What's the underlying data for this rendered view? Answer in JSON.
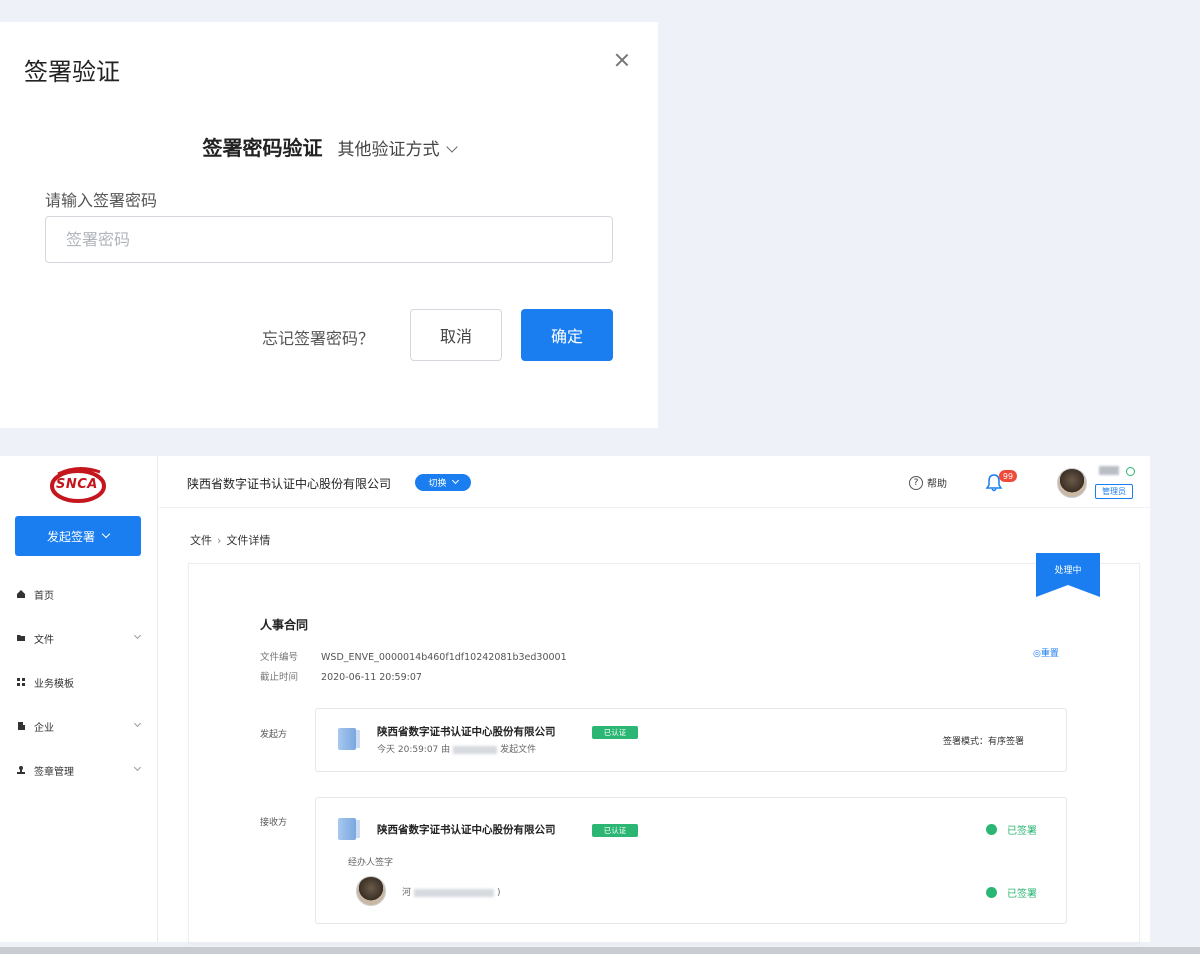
{
  "modal": {
    "title": "签署验证",
    "method": "签署密码验证",
    "other_method": "其他验证方式",
    "password_label": "请输入签署密码",
    "password_placeholder": "签署密码",
    "password_value": "",
    "forgot_link": "忘记签署密码？",
    "cancel_label": "取消",
    "confirm_label": "确定",
    "accent_color": "#1a7ef0"
  },
  "sidebar": {
    "logo_text": "SNCA",
    "start_button": "发起签署",
    "items": [
      {
        "label": "首页",
        "icon": "home-icon",
        "has_submenu": false
      },
      {
        "label": "文件",
        "icon": "folder-icon",
        "has_submenu": true
      },
      {
        "label": "业务模板",
        "icon": "grid-icon",
        "has_submenu": false
      },
      {
        "label": "企业",
        "icon": "building-icon",
        "has_submenu": true
      },
      {
        "label": "签章管理",
        "icon": "stamp-icon",
        "has_submenu": true
      }
    ]
  },
  "topbar": {
    "org_name": "陕西省数字证书认证中心股份有限公司",
    "org_switch": "切换",
    "help_label": "帮助",
    "notification_count": "99",
    "role_tag": "管理员"
  },
  "breadcrumb": {
    "root": "文件",
    "separator": "›",
    "current": "文件详情"
  },
  "document": {
    "status": "处理中",
    "title": "人事合同",
    "id_label": "文件编号",
    "id_value": "WSD_ENVE_0000014b460f1df10242081b3ed30001",
    "deadline_label": "截止时间",
    "deadline_value": "2020-06-11 20:59:07",
    "right_link": "◎重置",
    "sender_label": "发起方",
    "sender": {
      "company": "陕西省数字证书认证中心股份有限公司",
      "cert_tag": "已认证",
      "time_prefix": "今天 20:59:07 由",
      "time_suffix": "发起文件",
      "sign_mode": "签署模式：有序签署"
    },
    "receiver_label": "接收方",
    "receiver": {
      "company": "陕西省数字证书认证中心股份有限公司",
      "cert_tag": "已认证",
      "status": "已签署",
      "agent_label": "经办人签字",
      "agent_name_prefix": "河",
      "agent_name_suffix": ")",
      "agent_status": "已签署"
    },
    "status_color": "#2bb673"
  }
}
